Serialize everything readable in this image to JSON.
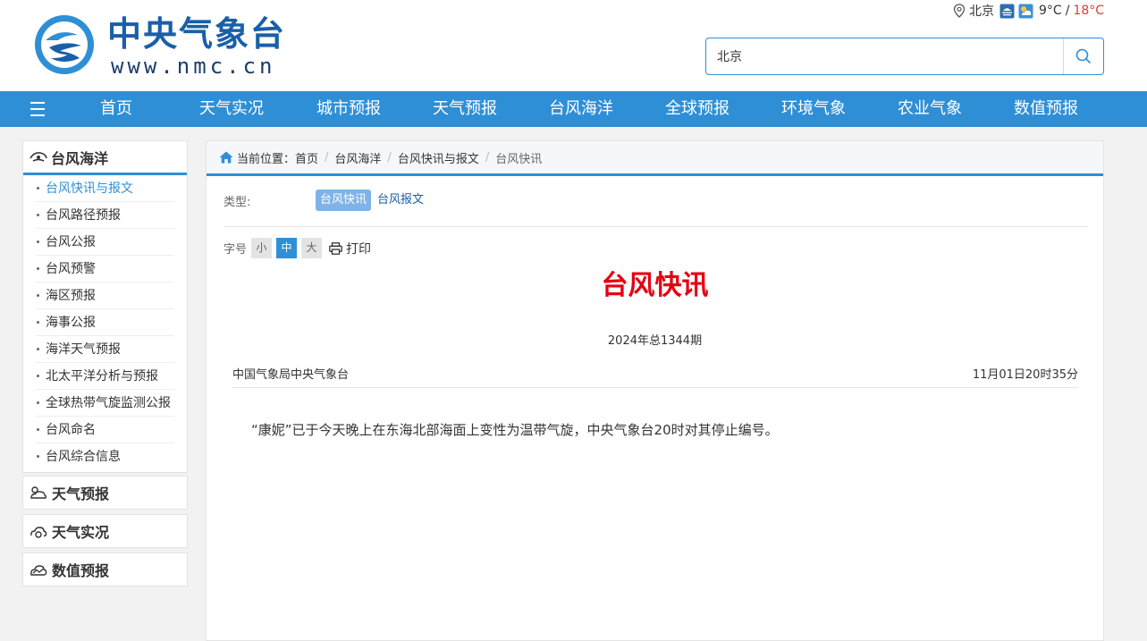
{
  "header": {
    "site_name": "中央气象台",
    "site_url": "www.nmc.cn",
    "weather": {
      "city": "北京",
      "temp_low": "9°C",
      "sep": "/",
      "temp_high": "18°C"
    },
    "search": {
      "value": "北京"
    }
  },
  "nav": {
    "items": [
      "首页",
      "天气实况",
      "城市预报",
      "天气预报",
      "台风海洋",
      "全球预报",
      "环境气象",
      "农业气象",
      "数值预报"
    ]
  },
  "sidebar": {
    "active_section": "台风海洋",
    "items": [
      "台风快讯与报文",
      "台风路径预报",
      "台风公报",
      "台风预警",
      "海区预报",
      "海事公报",
      "海洋天气预报",
      "北太平洋分析与预报",
      "全球热带气旋监测公报",
      "台风命名",
      "台风综合信息"
    ],
    "sections": [
      "天气预报",
      "天气实况",
      "数值预报"
    ]
  },
  "breadcrumb": {
    "prefix": "当前位置：",
    "items": [
      "首页",
      "台风海洋",
      "台风快讯与报文",
      "台风快讯"
    ]
  },
  "filter": {
    "label": "类型:",
    "tags": [
      "台风快讯",
      "台风报文"
    ]
  },
  "font_size": {
    "label": "字号",
    "options": [
      "小",
      "中",
      "大"
    ],
    "print": "打印"
  },
  "article": {
    "title": "台风快讯",
    "issue": "2024年总1344期",
    "source": "中国气象局中央气象台",
    "time": "11月01日20时35分",
    "body": "“康妮”已于今天晚上在东海北部海面上变性为温带气旋，中央气象台20时对其停止编号。"
  },
  "colors": {
    "primary": "#2f8fd6",
    "title_red": "#e60012",
    "temp_high": "#e53935"
  }
}
